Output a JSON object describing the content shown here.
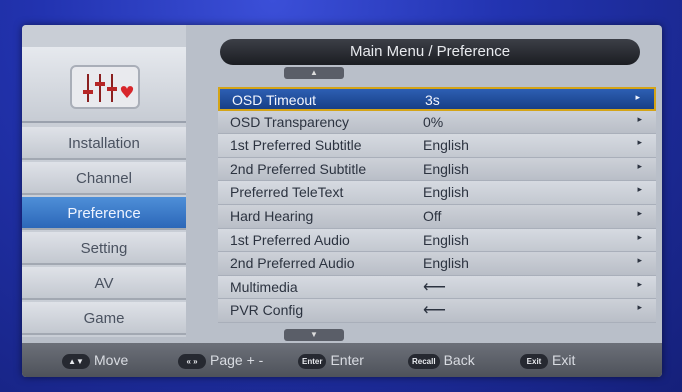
{
  "header": {
    "title": "Main Menu / Preference"
  },
  "sidebar": {
    "items": [
      {
        "label": "Installation",
        "active": false
      },
      {
        "label": "Channel",
        "active": false
      },
      {
        "label": "Preference",
        "active": true
      },
      {
        "label": "Setting",
        "active": false
      },
      {
        "label": "AV",
        "active": false
      },
      {
        "label": "Game",
        "active": false
      }
    ]
  },
  "menu": {
    "rows": [
      {
        "label": "OSD Timeout",
        "value": "3s",
        "selected": true
      },
      {
        "label": "OSD Transparency",
        "value": "0%"
      },
      {
        "label": "1st Preferred Subtitle",
        "value": "English"
      },
      {
        "label": "2nd Preferred Subtitle",
        "value": "English"
      },
      {
        "label": "Preferred TeleText",
        "value": "English"
      },
      {
        "label": "Hard Hearing",
        "value": "Off"
      },
      {
        "label": "1st Preferred Audio",
        "value": "English"
      },
      {
        "label": "2nd Preferred Audio",
        "value": "English"
      },
      {
        "label": "Multimedia",
        "value_icon": "enter-arrow-icon",
        "value_glyph": "⟵"
      },
      {
        "label": "PVR Config",
        "value_icon": "enter-arrow-icon",
        "value_glyph": "⟵"
      }
    ],
    "row_arrow_glyph": "▸"
  },
  "help_bar": {
    "move": {
      "key": "▲▼",
      "label": "Move"
    },
    "page": {
      "key": "« »",
      "label": "Page + -"
    },
    "enter": {
      "key": "Enter",
      "label": "Enter"
    },
    "back": {
      "key": "Recall",
      "label": "Back"
    },
    "exit": {
      "key": "Exit",
      "label": "Exit"
    }
  },
  "scroll": {
    "up_glyph": "▲",
    "down_glyph": "▼"
  },
  "colors": {
    "accent_selected": "#2d5fb3",
    "selected_border": "#d4a417",
    "sidebar_active": "#3a7bd0"
  }
}
